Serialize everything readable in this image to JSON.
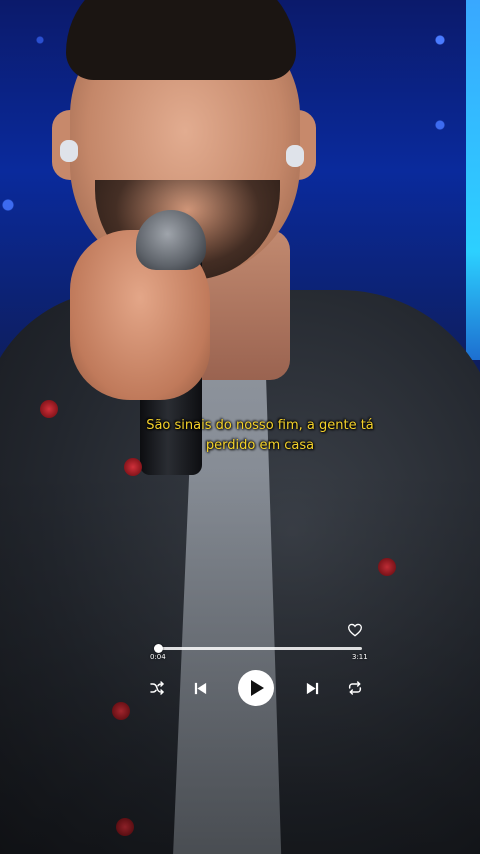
{
  "lyrics": {
    "line1": "São sinais do nosso fim, a gente tá",
    "line2": "perdido em casa"
  },
  "player": {
    "elapsed": "0:04",
    "total": "3:11",
    "progress_fraction": 0.02,
    "liked": false,
    "controls": {
      "shuffle_icon": "shuffle-icon",
      "previous_icon": "skip-previous-icon",
      "play_icon": "play-icon",
      "next_icon": "skip-next-icon",
      "repeat_icon": "repeat-icon",
      "like_icon": "heart-icon"
    }
  },
  "colors": {
    "lyric_text": "#f5d22a",
    "player_foreground": "#ffffff",
    "stage_light": "#0a2a9c"
  }
}
